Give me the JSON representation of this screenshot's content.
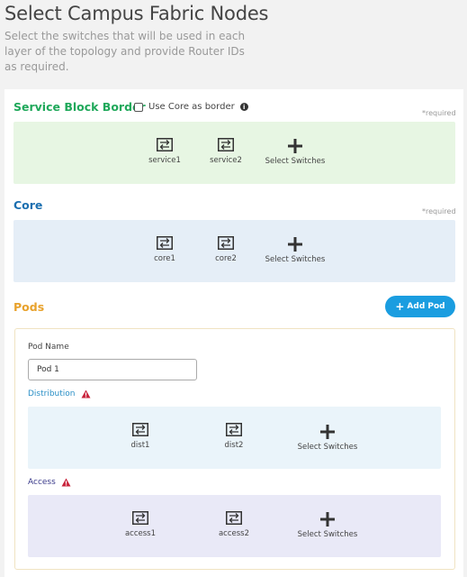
{
  "header": {
    "title": "Select Campus Fabric Nodes",
    "subtitle": "Select the switches that will be used in each layer of the topology and provide Router IDs as required."
  },
  "service_block": {
    "title": "Service Block Border",
    "checkbox_label": "Use Core as border",
    "checkbox_checked": false,
    "required": "*required",
    "nodes": [
      "service1",
      "service2"
    ],
    "select_label": "Select Switches"
  },
  "core": {
    "title": "Core",
    "required": "*required",
    "nodes": [
      "core1",
      "core2"
    ],
    "select_label": "Select Switches"
  },
  "pods": {
    "title": "Pods",
    "add_button_label": "Add Pod",
    "pod_name_label": "Pod Name",
    "pod_name_value": "Pod 1",
    "distribution": {
      "label": "Distribution",
      "nodes": [
        "dist1",
        "dist2"
      ],
      "select_label": "Select Switches"
    },
    "access": {
      "label": "Access",
      "nodes": [
        "access1",
        "access2"
      ],
      "select_label": "Select Switches"
    }
  },
  "colors": {
    "service_title": "#1fa85a",
    "core_title": "#1b6fb0",
    "pods_title": "#e8a22c",
    "add_button": "#1a9de0",
    "warning": "#c8223a"
  },
  "icons": {
    "switch": "switch-icon",
    "plus": "plus-icon",
    "info": "info-icon",
    "warning": "warning-icon"
  }
}
